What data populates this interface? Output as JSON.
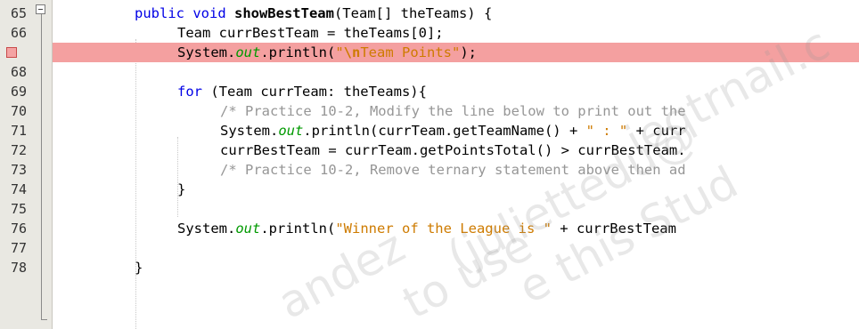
{
  "editor": {
    "lines": [
      {
        "num": "65",
        "segments": [
          {
            "t": "public void ",
            "c": "kw"
          },
          {
            "t": "showBestTeam",
            "c": "bold"
          },
          {
            "t": "(Team[] theTeams) {",
            "c": ""
          }
        ]
      },
      {
        "num": "66",
        "segments": [
          {
            "t": "Team currBestTeam = theTeams[0];",
            "c": ""
          }
        ]
      },
      {
        "num": "",
        "segments": [
          {
            "t": "System.",
            "c": ""
          },
          {
            "t": "out",
            "c": "static"
          },
          {
            "t": ".println(",
            "c": ""
          },
          {
            "t": "\"",
            "c": "str"
          },
          {
            "t": "\\n",
            "c": "esc"
          },
          {
            "t": "Team Points\"",
            "c": "str"
          },
          {
            "t": ");",
            "c": ""
          }
        ]
      },
      {
        "num": "68",
        "segments": []
      },
      {
        "num": "69",
        "segments": [
          {
            "t": "for",
            "c": "kw"
          },
          {
            "t": " (Team currTeam: theTeams){",
            "c": ""
          }
        ]
      },
      {
        "num": "70",
        "segments": [
          {
            "t": "/* Practice 10-2, Modify the line below to print out the",
            "c": "cmt"
          }
        ]
      },
      {
        "num": "71",
        "segments": [
          {
            "t": "System.",
            "c": ""
          },
          {
            "t": "out",
            "c": "static"
          },
          {
            "t": ".println(currTeam.getTeamName() + ",
            "c": ""
          },
          {
            "t": "\" : \"",
            "c": "str"
          },
          {
            "t": " + curr",
            "c": ""
          }
        ]
      },
      {
        "num": "72",
        "segments": [
          {
            "t": "currBestTeam = currTeam.getPointsTotal() > currBestTeam.",
            "c": ""
          }
        ]
      },
      {
        "num": "73",
        "segments": [
          {
            "t": "/* Practice 10-2, Remove ternary statement above then ad",
            "c": "cmt"
          }
        ]
      },
      {
        "num": "74",
        "segments": [
          {
            "t": "}",
            "c": ""
          }
        ]
      },
      {
        "num": "75",
        "segments": []
      },
      {
        "num": "76",
        "segments": [
          {
            "t": "System.",
            "c": ""
          },
          {
            "t": "out",
            "c": "static"
          },
          {
            "t": ".println(",
            "c": ""
          },
          {
            "t": "\"Winner of the League is \"",
            "c": "str"
          },
          {
            "t": " + currBestTeam",
            "c": ""
          }
        ]
      },
      {
        "num": "77",
        "segments": []
      },
      {
        "num": "78",
        "segments": [
          {
            "t": "}",
            "c": ""
          }
        ]
      }
    ],
    "watermark": [
      "ieqtrnail.c",
      "(juliettedu@",
      "e this Stud",
      "andez",
      "to use"
    ]
  },
  "colors": {
    "keyword": "#0000e6",
    "string": "#ce7b00",
    "static_field": "#009900",
    "comment": "#969696",
    "breakpoint_line": "#f4a0a0"
  },
  "icons": {
    "breakpoint": "breakpoint-icon",
    "fold": "fold-collapse-icon"
  }
}
